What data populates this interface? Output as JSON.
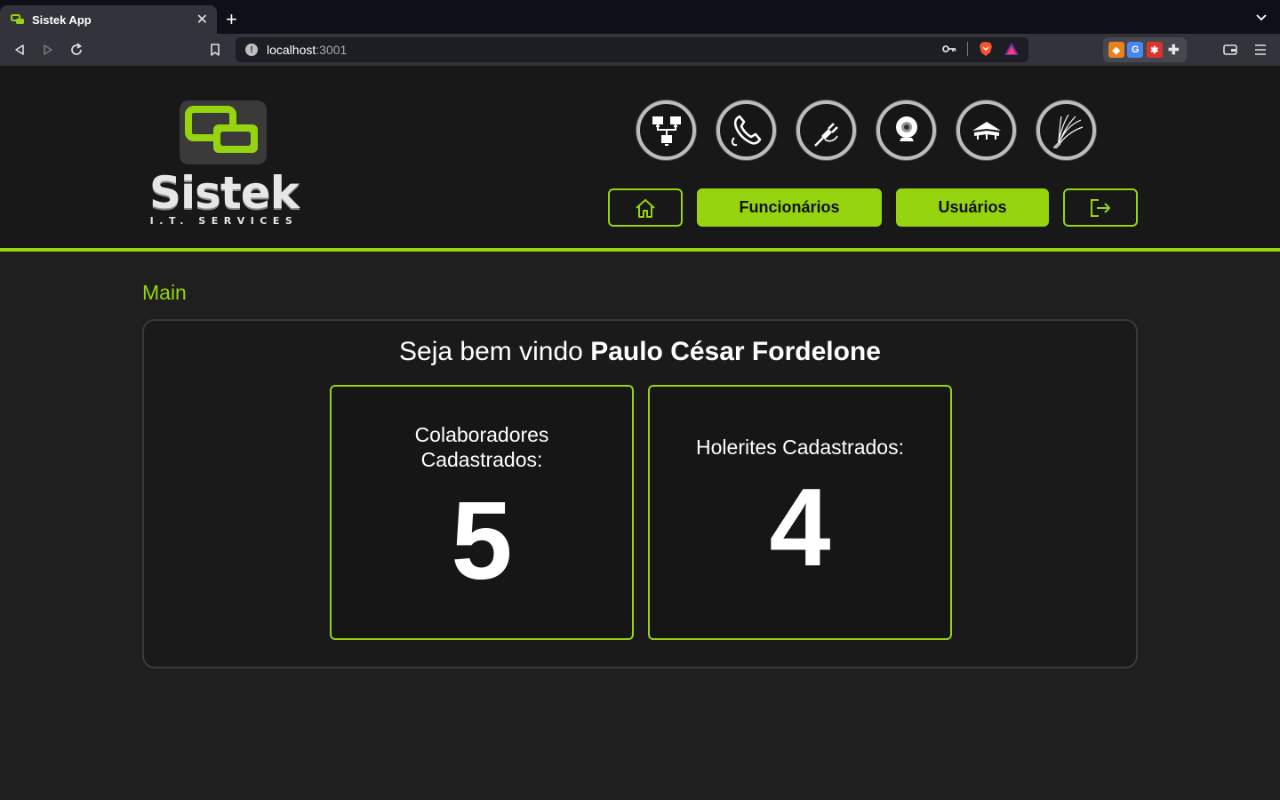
{
  "browser": {
    "tab_title": "Sistek App",
    "url_host": "localhost",
    "url_port": ":3001"
  },
  "brand": {
    "name": "Sistek",
    "tagline": "I.T. SERVICES",
    "accent_color": "#95d40f"
  },
  "services": [
    {
      "icon": "network-icon"
    },
    {
      "icon": "telephone-icon"
    },
    {
      "icon": "electrical-plug-icon"
    },
    {
      "icon": "webcam-icon"
    },
    {
      "icon": "cabling-icon"
    },
    {
      "icon": "fiber-optic-icon"
    }
  ],
  "nav": {
    "home_icon": "home-icon",
    "employees_label": "Funcionários",
    "users_label": "Usuários",
    "logout_icon": "logout-icon"
  },
  "main": {
    "breadcrumb": "Main",
    "welcome_prefix": "Seja bem vindo",
    "user_name": "Paulo César Fordelone",
    "stats": [
      {
        "label": "Colaboradores Cadastrados:",
        "value": "5"
      },
      {
        "label": "Holerites Cadastrados:",
        "value": "4"
      }
    ]
  }
}
